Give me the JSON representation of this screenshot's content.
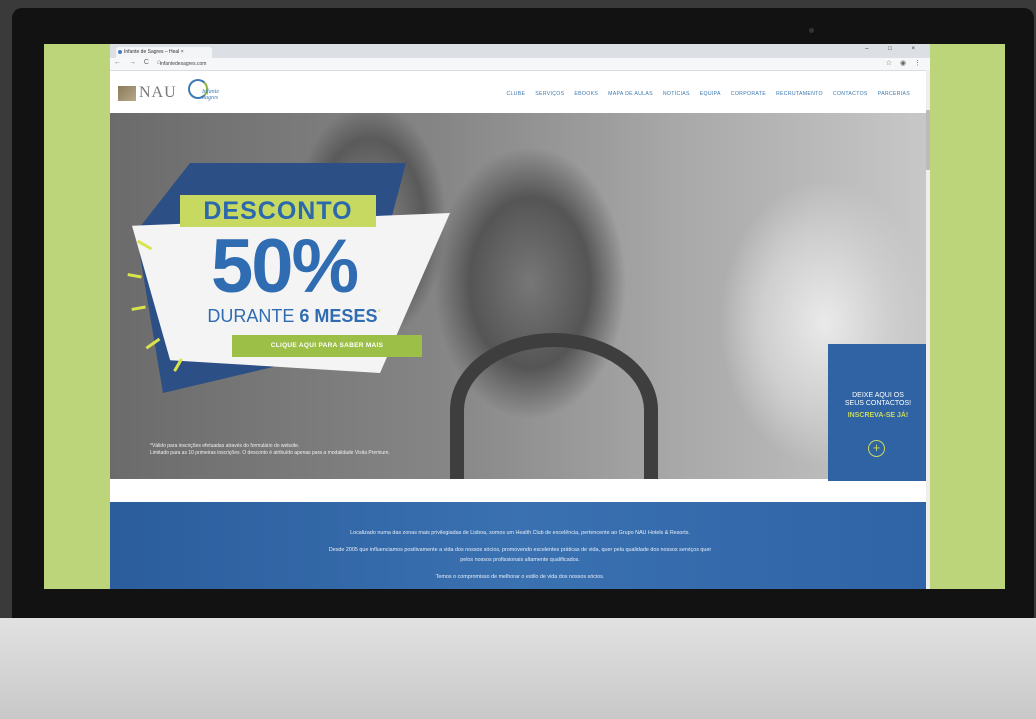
{
  "browser": {
    "tab_title": "Infante de Sagres – Heal ×",
    "url": "infantedesagres.com",
    "nav_icons": "← → C ⌂",
    "toolbar_icons": "☆ ◉ ⋮",
    "window_controls": "– □ ×"
  },
  "header": {
    "logo_primary": "NAU",
    "logo_secondary_line1": "Infante",
    "logo_secondary_line2": "Sagres"
  },
  "nav": [
    "CLUBE",
    "SERVIÇOS",
    "EBOOKS",
    "MAPA DE AULAS",
    "NOTÍCIAS",
    "EQUIPA",
    "CORPORATE",
    "RECRUTAMENTO",
    "CONTACTOS",
    "PARCERIAS"
  ],
  "promo": {
    "title": "DESCONTO",
    "percent": "50%",
    "subtitle_pre": "DURANTE ",
    "subtitle_bold": "6 MESES",
    "asterisk": "*",
    "button": "CLIQUE AQUI PARA SABER MAIS"
  },
  "disclaimer": {
    "line1": "*Válido para inscrições efetuadas através do formulário do website.",
    "line2": "Limitado para as 10 primeiras inscrições. O desconto é atribuído apenas para a modalidade Visita Premium."
  },
  "contact_box": {
    "line1": "DEIXE AQUI OS",
    "line2": "SEUS CONTACTOS!",
    "line3": "INSCREVA-SE JÁ!",
    "plus": "+"
  },
  "intro": {
    "line1": "Localizado numa das zonas mais privilegiadas de Lisboa, somos um Health Club de excelência, pertencente ao Grupo NAU Hotels & Resorts.",
    "line2": "Desde 2005 que influenciamos positivamente a vida dos nossos sócios, promovendo excelentes práticas de vida, quer pela qualidade dos nossos serviços quer",
    "line3": "pelos nossos profissionais altamente qualificados.",
    "line4": "Temos o compromisso de melhorar o estilo de vida dos nossos sócios."
  },
  "colors": {
    "brand_blue": "#2f6cb1",
    "brand_green": "#c7d960",
    "background_green": "#bdd57a"
  }
}
